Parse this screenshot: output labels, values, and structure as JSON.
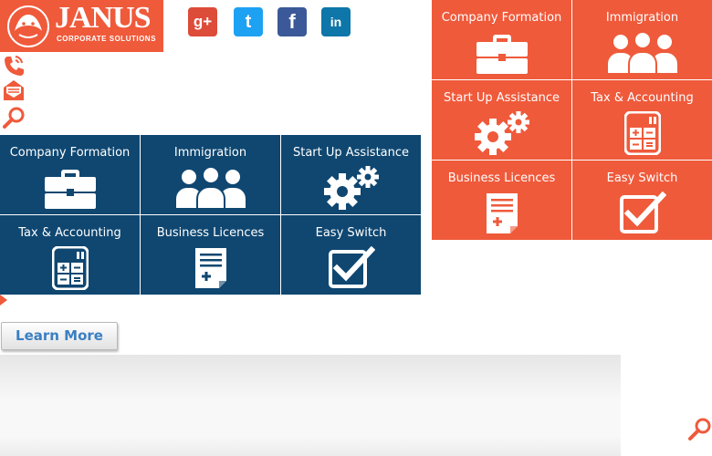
{
  "brand": {
    "name": "JANUS",
    "tagline": "CORPORATE SOLUTIONS",
    "color": "#ef5a3b"
  },
  "social": [
    {
      "name": "google-plus",
      "glyph": "g+",
      "color": "#dd4b39"
    },
    {
      "name": "twitter",
      "glyph": "t",
      "color": "#1da1f2"
    },
    {
      "name": "facebook",
      "glyph": "f",
      "color": "#3b5998"
    },
    {
      "name": "linkedin",
      "glyph": "in",
      "color": "#0e76a8"
    }
  ],
  "side_icons": [
    "phone-icon",
    "mail-icon",
    "search-icon"
  ],
  "services_blue": {
    "color": "#0f4771",
    "tiles": [
      {
        "label": "Company Formation",
        "icon": "briefcase-icon"
      },
      {
        "label": "Immigration",
        "icon": "people-icon"
      },
      {
        "label": "Start Up Assistance",
        "icon": "gears-icon"
      },
      {
        "label": "Tax & Accounting",
        "icon": "calculator-icon"
      },
      {
        "label": "Business Licences",
        "icon": "document-icon"
      },
      {
        "label": "Easy Switch",
        "icon": "checkbox-icon"
      }
    ]
  },
  "services_orange": {
    "color": "#ef5a3b",
    "tiles": [
      {
        "label": "Company Formation",
        "icon": "briefcase-icon"
      },
      {
        "label": "Immigration",
        "icon": "people-icon"
      },
      {
        "label": "Start Up Assistance",
        "icon": "gears-icon"
      },
      {
        "label": "Tax & Accounting",
        "icon": "calculator-icon"
      },
      {
        "label": "Business Licences",
        "icon": "document-icon"
      },
      {
        "label": "Easy Switch",
        "icon": "checkbox-icon"
      }
    ]
  },
  "cta": {
    "learn_more": "Learn More",
    "color": "#3a7fc2"
  }
}
